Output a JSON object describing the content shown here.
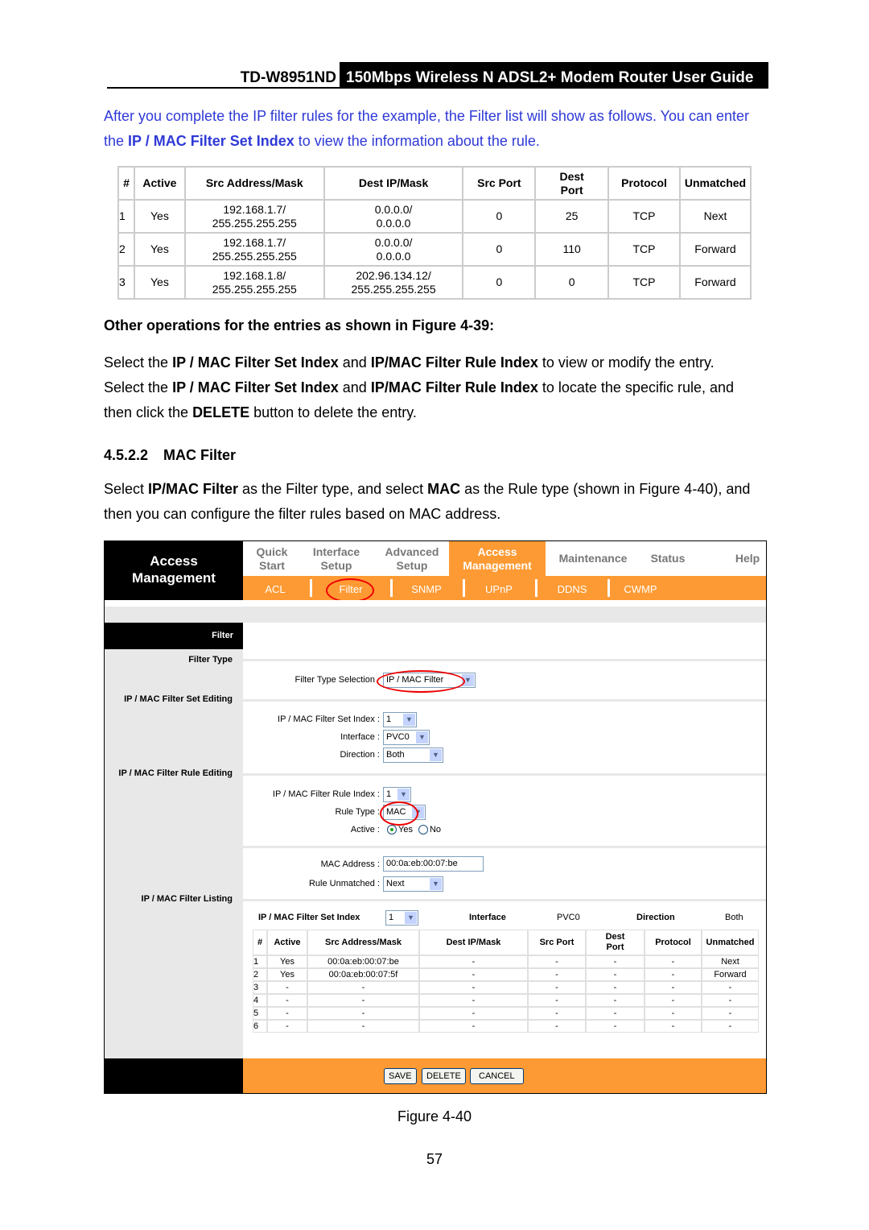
{
  "header": {
    "model": "TD-W8951ND",
    "title": "150Mbps Wireless N ADSL2+ Modem Router User Guide"
  },
  "intro": {
    "t1": "After you complete the IP filter rules for the example, the Filter list will show as follows. You can enter the ",
    "b1": "IP / MAC Filter Set Index",
    "t2": " to view the information about the rule."
  },
  "table1": {
    "headers": [
      "#",
      "Active",
      "Src Address/Mask",
      "Dest IP/Mask",
      "Src Port",
      "Dest Port",
      "Protocol",
      "Unmatched"
    ],
    "rows": [
      [
        "1",
        "Yes",
        "192.168.1.7/ 255.255.255.255",
        "0.0.0.0/ 0.0.0.0",
        "0",
        "25",
        "TCP",
        "Next"
      ],
      [
        "2",
        "Yes",
        "192.168.1.7/ 255.255.255.255",
        "0.0.0.0/ 0.0.0.0",
        "0",
        "110",
        "TCP",
        "Forward"
      ],
      [
        "3",
        "Yes",
        "192.168.1.8/ 255.255.255.255",
        "202.96.134.12/ 255.255.255.255",
        "0",
        "0",
        "TCP",
        "Forward"
      ]
    ]
  },
  "ops_heading": "Other operations for the entries as shown in Figure 4-39:",
  "ops": {
    "a1": "Select the ",
    "a2": "IP / MAC Filter Set Index",
    "a3": " and ",
    "a4": "IP/MAC Filter Rule Index",
    "a5": " to view or modify the entry.",
    "b1": "Select the ",
    "b2": "IP / MAC Filter Set Index",
    "b3": " and ",
    "b4": "IP/MAC Filter Rule Index",
    "b5": " to locate the specific rule, and then click the ",
    "b6": "DELETE",
    "b7": " button to delete the entry."
  },
  "section": {
    "num": "4.5.2.2",
    "title": "MAC Filter"
  },
  "mac_para": {
    "t1": "Select ",
    "b1": "IP/MAC Filter",
    "t2": " as the Filter type, and select ",
    "b2": "MAC",
    "t3": " as the Rule type (shown in Figure 4-40), and then you can configure the filter rules based on MAC address."
  },
  "ui": {
    "brand": "Access Management",
    "nav": [
      "Quick Start",
      "Interface Setup",
      "Advanced Setup",
      "Access Management",
      "Maintenance",
      "Status",
      "Help"
    ],
    "subnav": [
      "ACL",
      "Filter",
      "SNMP",
      "UPnP",
      "DDNS",
      "CWMP"
    ],
    "side": {
      "filter": "Filter",
      "filter_type": "Filter Type",
      "set_editing": "IP / MAC Filter Set Editing",
      "rule_editing": "IP / MAC Filter Rule Editing",
      "listing": "IP / MAC Filter Listing"
    },
    "form": {
      "filter_type_label": "Filter Type Selection",
      "filter_type": "IP / MAC Filter",
      "set_index_label": "IP / MAC Filter Set Index :",
      "set_index": "1",
      "interface_label": "Interface :",
      "interface": "PVC0",
      "direction_label": "Direction :",
      "direction": "Both",
      "rule_index_label": "IP / MAC Filter Rule Index :",
      "rule_index": "1",
      "rule_type_label": "Rule Type :",
      "rule_type": "MAC",
      "active_label": "Active :",
      "yes": "Yes",
      "no": "No",
      "active_value": "Yes",
      "mac_label": "MAC Address :",
      "mac": "00:0a:eb:00:07:be",
      "unmatched_label": "Rule Unmatched :",
      "unmatched": "Next"
    },
    "listing": {
      "set_index_label": "IP / MAC Filter Set Index",
      "set_index": "1",
      "interface_label": "Interface",
      "interface": "PVC0",
      "direction_label": "Direction",
      "direction": "Both",
      "headers": [
        "#",
        "Active",
        "Src Address/Mask",
        "Dest IP/Mask",
        "Src Port",
        "Dest Port",
        "Protocol",
        "Unmatched"
      ],
      "rows": [
        [
          "1",
          "Yes",
          "00:0a:eb:00:07:be",
          "-",
          "-",
          "-",
          "-",
          "Next"
        ],
        [
          "2",
          "Yes",
          "00:0a:eb:00:07:5f",
          "-",
          "-",
          "-",
          "-",
          "Forward"
        ],
        [
          "3",
          "-",
          "-",
          "-",
          "-",
          "-",
          "-",
          "-"
        ],
        [
          "4",
          "-",
          "-",
          "-",
          "-",
          "-",
          "-",
          "-"
        ],
        [
          "5",
          "-",
          "-",
          "-",
          "-",
          "-",
          "-",
          "-"
        ],
        [
          "6",
          "-",
          "-",
          "-",
          "-",
          "-",
          "-",
          "-"
        ]
      ]
    },
    "buttons": {
      "save": "SAVE",
      "delete": "DELETE",
      "cancel": "CANCEL"
    },
    "colors": {
      "accent": "#fe9a33",
      "highlight": "#e00000"
    }
  },
  "caption": "Figure 4-40",
  "page_number": "57"
}
